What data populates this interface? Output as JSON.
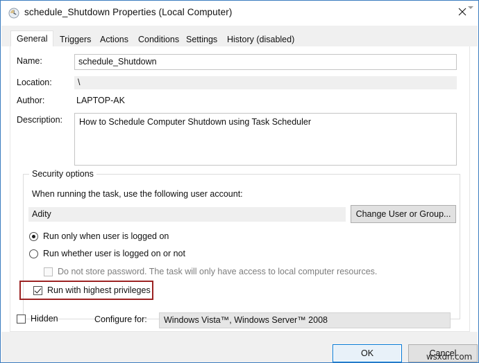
{
  "window": {
    "title": "schedule_Shutdown Properties (Local Computer)",
    "icon": "task-scheduler-clock-icon",
    "close_label": "✕",
    "border_color": "#3a7bbf"
  },
  "tabs": [
    {
      "label": "General",
      "active": true
    },
    {
      "label": "Triggers",
      "active": false
    },
    {
      "label": "Actions",
      "active": false
    },
    {
      "label": "Conditions",
      "active": false
    },
    {
      "label": "Settings",
      "active": false
    },
    {
      "label": "History (disabled)",
      "active": false
    }
  ],
  "general": {
    "name": {
      "label": "Name:",
      "value": "schedule_Shutdown"
    },
    "location": {
      "label": "Location:",
      "value": "\\"
    },
    "author": {
      "label": "Author:",
      "value": "LAPTOP-AK"
    },
    "description": {
      "label": "Description:",
      "value": "How to Schedule Computer Shutdown using Task Scheduler"
    }
  },
  "security_options": {
    "group_title": "Security options",
    "account_prompt": "When running the task, use the following user account:",
    "account_value": "Adity",
    "change_user_button": "Change User or Group...",
    "run_only_logged_on": {
      "label": "Run only when user is logged on",
      "checked": true
    },
    "run_whether_logged_on": {
      "label": "Run whether user is logged on or not",
      "checked": false
    },
    "do_not_store_password": {
      "label": "Do not store password.  The task will only have access to local computer resources.",
      "checked": false,
      "disabled": true
    },
    "run_highest_privileges": {
      "label": "Run with highest privileges",
      "checked": true,
      "highlight_color": "#9b2222"
    },
    "hidden": {
      "label": "Hidden",
      "checked": false
    },
    "configure_for": {
      "label": "Configure for:",
      "value": "Windows Vista™, Windows Server™ 2008"
    }
  },
  "footer": {
    "ok_label": "OK",
    "cancel_label": "Cancel"
  },
  "watermark": "wsxdn.com"
}
